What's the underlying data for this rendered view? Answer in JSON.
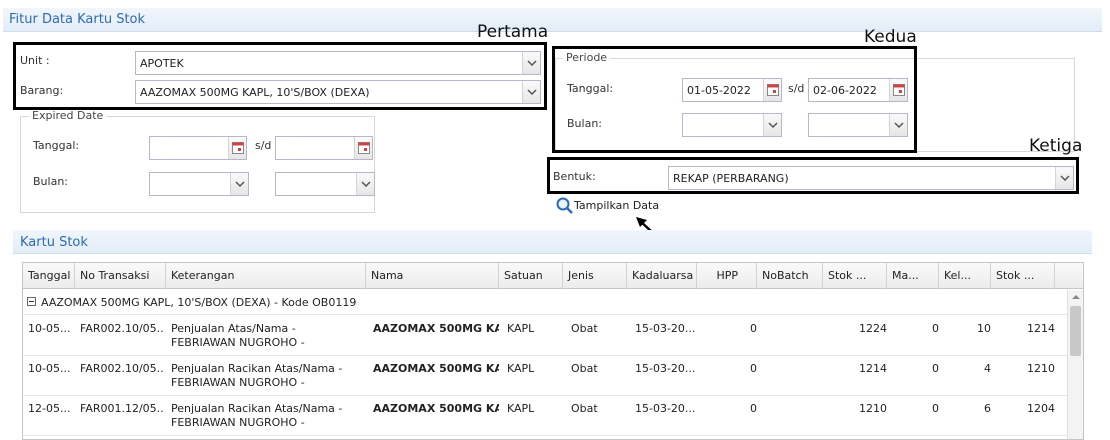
{
  "fitur": {
    "title": "Fitur Data Kartu Stok",
    "unit_label": "Unit :",
    "unit_value": "APOTEK",
    "barang_label": "Barang:",
    "barang_value": "AAZOMAX 500MG KAPL, 10'S/BOX (DEXA)",
    "expired": {
      "legend": "Expired Date",
      "tanggal_label": "Tanggal:",
      "sd_label": "s/d",
      "bulan_label": "Bulan:",
      "tanggal_from": "",
      "tanggal_to": "",
      "bulan_from": "",
      "bulan_to": ""
    },
    "periode": {
      "legend": "Periode",
      "tanggal_label": "Tanggal:",
      "sd_label": "s/d",
      "tanggal_from": "01-05-2022",
      "tanggal_to": "02-06-2022",
      "bulan_label": "Bulan:",
      "bulan_from": "",
      "bulan_to": ""
    },
    "bentuk_label": "Bentuk:",
    "bentuk_value": "REKAP (PERBARANG)",
    "tampilkan_label": "Tampilkan Data"
  },
  "annotations": {
    "pertama": "Pertama",
    "kedua": "Kedua",
    "ketiga": "Ketiga"
  },
  "kartu": {
    "title": "Kartu Stok",
    "columns": [
      "Tanggal",
      "No Transaksi",
      "Keterangan",
      "Nama",
      "Satuan",
      "Jenis",
      "Kadaluarsa",
      "HPP",
      "NoBatch",
      "Stok ...",
      "Ma...",
      "Kel...",
      "Stok ..."
    ],
    "group": "AAZOMAX 500MG KAPL, 10'S/BOX (DEXA) - Kode OB0119",
    "rows": [
      {
        "tanggal": "10-05...",
        "no": "FAR002.10/05...",
        "ket": "Penjualan Atas/Nama - FEBRIAWAN NUGROHO -",
        "nama": "AAZOMAX 500MG KA...",
        "satuan": "KAPL",
        "jenis": "Obat",
        "kadaluarsa": "15-03-20...",
        "hpp": "0",
        "nobatch": "",
        "stok_awal": "1224",
        "masuk": "0",
        "keluar": "10",
        "stok_akhir": "1214"
      },
      {
        "tanggal": "10-05...",
        "no": "FAR002.10/05...",
        "ket": "Penjualan Racikan Atas/Nama - FEBRIAWAN NUGROHO -",
        "nama": "AAZOMAX 500MG KA...",
        "satuan": "KAPL",
        "jenis": "Obat",
        "kadaluarsa": "15-03-20...",
        "hpp": "0",
        "nobatch": "",
        "stok_awal": "1214",
        "masuk": "0",
        "keluar": "4",
        "stok_akhir": "1210"
      },
      {
        "tanggal": "12-05...",
        "no": "FAR001.12/05...",
        "ket": "Penjualan Racikan Atas/Nama - FEBRIAWAN NUGROHO -",
        "nama": "AAZOMAX 500MG KA...",
        "satuan": "KAPL",
        "jenis": "Obat",
        "kadaluarsa": "15-03-20...",
        "hpp": "0",
        "nobatch": "",
        "stok_awal": "1210",
        "masuk": "0",
        "keluar": "6",
        "stok_akhir": "1204"
      }
    ]
  },
  "icons": {
    "combo_trigger": "chevron-down-icon",
    "date_trigger": "calendar-icon",
    "search": "magnifier-icon",
    "arrow": "arrow-annotation-icon"
  }
}
